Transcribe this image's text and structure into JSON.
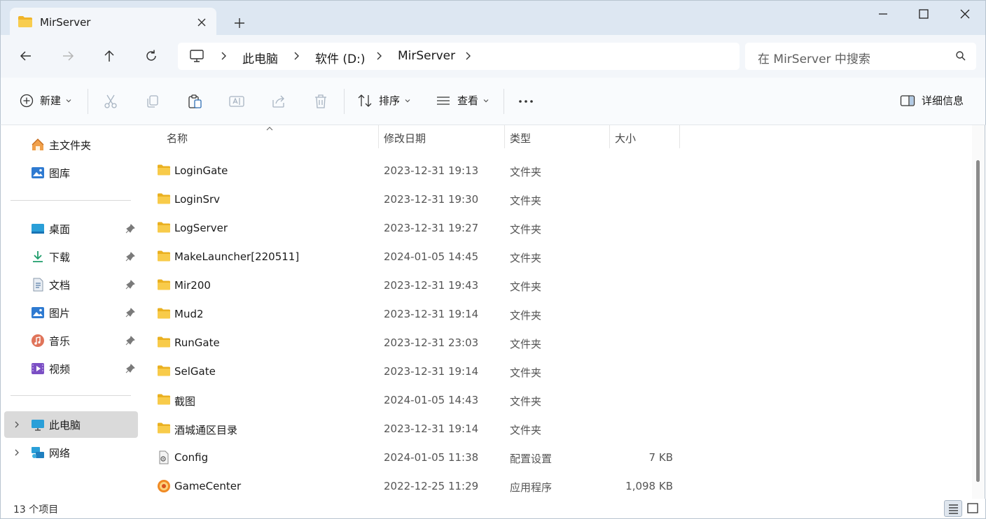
{
  "window": {
    "tab_title": "MirServer"
  },
  "breadcrumb": {
    "items": [
      "此电脑",
      "软件 (D:)",
      "MirServer"
    ]
  },
  "search": {
    "placeholder": "在 MirServer 中搜索"
  },
  "commands": {
    "new_label": "新建",
    "sort_label": "排序",
    "view_label": "查看",
    "details_label": "详细信息"
  },
  "sidebar": {
    "items": [
      {
        "label": "主文件夹",
        "icon": "home-icon"
      },
      {
        "label": "图库",
        "icon": "gallery-icon"
      },
      {
        "label": "桌面",
        "icon": "desktop-icon"
      },
      {
        "label": "下载",
        "icon": "download-icon"
      },
      {
        "label": "文档",
        "icon": "document-icon"
      },
      {
        "label": "图片",
        "icon": "pictures-icon"
      },
      {
        "label": "音乐",
        "icon": "music-icon"
      },
      {
        "label": "视频",
        "icon": "video-icon"
      },
      {
        "label": "此电脑",
        "icon": "this-pc-icon"
      },
      {
        "label": "网络",
        "icon": "network-icon"
      }
    ]
  },
  "columns": {
    "name": "名称",
    "modified": "修改日期",
    "type": "类型",
    "size": "大小"
  },
  "files": [
    {
      "name": "LoginGate",
      "modified": "2023-12-31 19:13",
      "type": "文件夹",
      "size": "",
      "icon": "folder-icon"
    },
    {
      "name": "LoginSrv",
      "modified": "2023-12-31 19:30",
      "type": "文件夹",
      "size": "",
      "icon": "folder-icon"
    },
    {
      "name": "LogServer",
      "modified": "2023-12-31 19:27",
      "type": "文件夹",
      "size": "",
      "icon": "folder-icon"
    },
    {
      "name": "MakeLauncher[220511]",
      "modified": "2024-01-05 14:45",
      "type": "文件夹",
      "size": "",
      "icon": "folder-icon"
    },
    {
      "name": "Mir200",
      "modified": "2023-12-31 19:43",
      "type": "文件夹",
      "size": "",
      "icon": "folder-icon"
    },
    {
      "name": "Mud2",
      "modified": "2023-12-31 19:14",
      "type": "文件夹",
      "size": "",
      "icon": "folder-icon"
    },
    {
      "name": "RunGate",
      "modified": "2023-12-31 23:03",
      "type": "文件夹",
      "size": "",
      "icon": "folder-icon"
    },
    {
      "name": "SelGate",
      "modified": "2023-12-31 19:14",
      "type": "文件夹",
      "size": "",
      "icon": "folder-icon"
    },
    {
      "name": "截图",
      "modified": "2024-01-05 14:43",
      "type": "文件夹",
      "size": "",
      "icon": "folder-icon"
    },
    {
      "name": "酒城通区目录",
      "modified": "2023-12-31 19:14",
      "type": "文件夹",
      "size": "",
      "icon": "folder-icon"
    },
    {
      "name": "Config",
      "modified": "2024-01-05 11:38",
      "type": "配置设置",
      "size": "7 KB",
      "icon": "config-file-icon"
    },
    {
      "name": "GameCenter",
      "modified": "2022-12-25 11:29",
      "type": "应用程序",
      "size": "1,098 KB",
      "icon": "app-icon"
    }
  ],
  "status": {
    "item_count": "13 个项目"
  },
  "colors": {
    "titlebar_bg": "#dde7f2",
    "folder_yellow": "#f5c243",
    "selection_gray": "#dadada"
  }
}
